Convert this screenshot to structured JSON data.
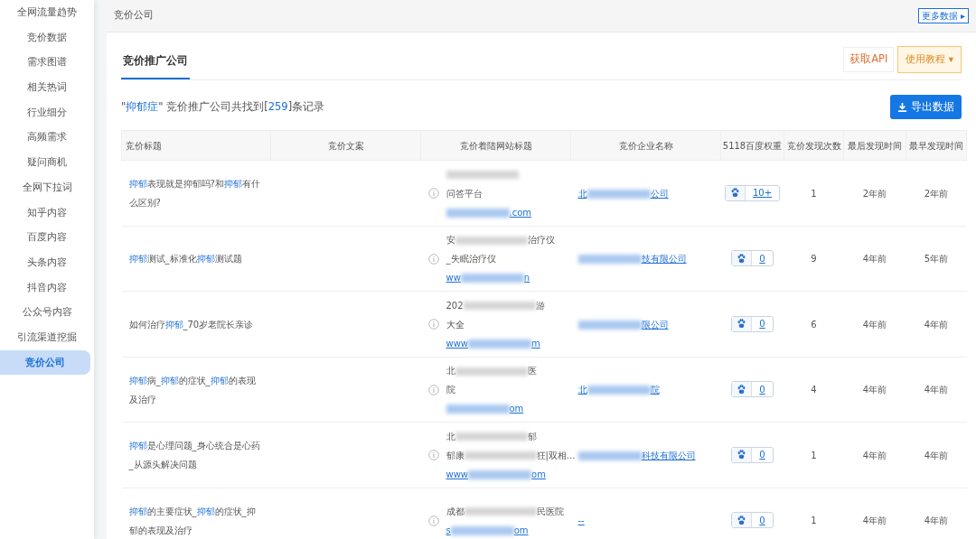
{
  "sidebar": {
    "items": [
      {
        "label": "全网流量趋势",
        "selected": false
      },
      {
        "label": "竞价数据",
        "selected": false
      },
      {
        "label": "需求图谱",
        "selected": false
      },
      {
        "label": "相关热词",
        "selected": false
      },
      {
        "label": "行业细分",
        "selected": false
      },
      {
        "label": "高频需求",
        "selected": false
      },
      {
        "label": "疑问商机",
        "selected": false
      },
      {
        "label": "全网下拉词",
        "selected": false
      },
      {
        "label": "知乎内容",
        "selected": false
      },
      {
        "label": "百度内容",
        "selected": false
      },
      {
        "label": "头条内容",
        "selected": false
      },
      {
        "label": "抖音内容",
        "selected": false
      },
      {
        "label": "公众号内容",
        "selected": false
      },
      {
        "label": "引流渠道挖掘",
        "selected": false
      },
      {
        "label": "竞价公司",
        "selected": true
      }
    ]
  },
  "header": {
    "title": "竞价公司",
    "more_button": "更多数据",
    "more_arrow": "▸"
  },
  "tabs": [
    {
      "label": "竞价推广公司",
      "selected": true
    }
  ],
  "actions": {
    "api_button": "获取API",
    "tutorial_button": "使用教程",
    "tutorial_caret": "▾",
    "export_button": "导出数据"
  },
  "summary": [
    {
      "text": "\"",
      "highlight": false
    },
    {
      "text": "抑郁症",
      "highlight": true
    },
    {
      "text": "\" 竞价推广公司共找到[",
      "highlight": false
    },
    {
      "text": "259",
      "highlight": true
    },
    {
      "text": "]条记录",
      "highlight": false
    }
  ],
  "table": {
    "columns": [
      "竞价标题",
      "竞价文案",
      "竞价着陆网站标题",
      "竞价企业名称",
      "5118百度权重",
      "竞价发现次数",
      "最后发现时间",
      "最早发现时间"
    ],
    "rows": [
      {
        "title": [
          {
            "text": "抑郁",
            "highlight": true
          },
          {
            "text": "表现就是抑郁吗?和",
            "highlight": false
          },
          {
            "text": "抑郁",
            "highlight": true
          },
          {
            "text": "有什么区别?",
            "highlight": false
          }
        ],
        "landing": [
          [
            {
              "kind": "blur"
            }
          ],
          [
            {
              "kind": "text",
              "text": "问答平台"
            }
          ]
        ],
        "url": [
          {
            "kind": "blur"
          },
          {
            "kind": "text",
            "text": ".com"
          }
        ],
        "company": [
          {
            "kind": "text",
            "text": "北"
          },
          {
            "kind": "blur"
          },
          {
            "kind": "text",
            "text": "公司"
          }
        ],
        "weight": "10+",
        "count": "1",
        "last": "2年前",
        "first": "2年前"
      },
      {
        "title": [
          {
            "text": "抑郁",
            "highlight": true
          },
          {
            "text": "测试_标准化",
            "highlight": false
          },
          {
            "text": "抑郁",
            "highlight": true
          },
          {
            "text": "测试题",
            "highlight": false
          }
        ],
        "landing": [
          [
            {
              "kind": "text",
              "text": "安"
            },
            {
              "kind": "blur"
            },
            {
              "kind": "text",
              "text": "治疗仪"
            }
          ],
          [
            {
              "kind": "text",
              "text": "_失眠治疗仪"
            }
          ]
        ],
        "url": [
          {
            "kind": "text",
            "text": "ww"
          },
          {
            "kind": "blur"
          },
          {
            "kind": "text",
            "text": "n"
          }
        ],
        "company": [
          {
            "kind": "blur"
          },
          {
            "kind": "text",
            "text": "技有限公司"
          }
        ],
        "weight": "0",
        "count": "9",
        "last": "4年前",
        "first": "5年前"
      },
      {
        "title": [
          {
            "text": "如何治疗",
            "highlight": false
          },
          {
            "text": "抑郁",
            "highlight": true
          },
          {
            "text": "_70岁老院长亲诊",
            "highlight": false
          }
        ],
        "landing": [
          [
            {
              "kind": "text",
              "text": "202"
            },
            {
              "kind": "blur"
            },
            {
              "kind": "text",
              "text": "游"
            }
          ],
          [
            {
              "kind": "text",
              "text": "大全"
            }
          ]
        ],
        "url": [
          {
            "kind": "text",
            "text": "www"
          },
          {
            "kind": "blur"
          },
          {
            "kind": "text",
            "text": "m"
          }
        ],
        "company": [
          {
            "kind": "blur"
          },
          {
            "kind": "text",
            "text": "限公司"
          }
        ],
        "weight": "0",
        "count": "6",
        "last": "4年前",
        "first": "4年前"
      },
      {
        "title": [
          {
            "text": "抑郁",
            "highlight": true
          },
          {
            "text": "病_",
            "highlight": false
          },
          {
            "text": "抑郁",
            "highlight": true
          },
          {
            "text": "的症状_",
            "highlight": false
          },
          {
            "text": "抑郁",
            "highlight": true
          },
          {
            "text": "的表现及治疗",
            "highlight": false
          }
        ],
        "landing": [
          [
            {
              "kind": "text",
              "text": "北"
            },
            {
              "kind": "blur"
            },
            {
              "kind": "text",
              "text": "医"
            }
          ],
          [
            {
              "kind": "text",
              "text": "院"
            }
          ]
        ],
        "url": [
          {
            "kind": "blur"
          },
          {
            "kind": "text",
            "text": "om"
          }
        ],
        "company": [
          {
            "kind": "text",
            "text": "北"
          },
          {
            "kind": "blur"
          },
          {
            "kind": "text",
            "text": "院"
          }
        ],
        "weight": "0",
        "count": "4",
        "last": "4年前",
        "first": "4年前"
      },
      {
        "title": [
          {
            "text": "抑郁",
            "highlight": true
          },
          {
            "text": "是心理问题_身心统合是心药_从源头解决问题",
            "highlight": false
          }
        ],
        "landing": [
          [
            {
              "kind": "text",
              "text": "北"
            },
            {
              "kind": "blur"
            },
            {
              "kind": "text",
              "text": "郁"
            }
          ],
          [
            {
              "kind": "text",
              "text": "郁康"
            },
            {
              "kind": "blur"
            },
            {
              "kind": "text",
              "text": "狂|双相..."
            }
          ]
        ],
        "url": [
          {
            "kind": "text",
            "text": "www"
          },
          {
            "kind": "blur"
          },
          {
            "kind": "text",
            "text": "om"
          }
        ],
        "company": [
          {
            "kind": "blur"
          },
          {
            "kind": "text",
            "text": "科技有限公司"
          }
        ],
        "weight": "0",
        "count": "1",
        "last": "4年前",
        "first": "4年前"
      },
      {
        "title": [
          {
            "text": "抑郁",
            "highlight": true
          },
          {
            "text": "的主要症状_",
            "highlight": false
          },
          {
            "text": "抑郁",
            "highlight": true
          },
          {
            "text": "的症状_抑郁的表现及治疗",
            "highlight": false
          }
        ],
        "landing": [
          [
            {
              "kind": "text",
              "text": "成都"
            },
            {
              "kind": "blur"
            },
            {
              "kind": "text",
              "text": "民医院"
            }
          ]
        ],
        "url": [
          {
            "kind": "text",
            "text": "s"
          },
          {
            "kind": "blur"
          },
          {
            "kind": "text",
            "text": "om"
          }
        ],
        "company": [
          {
            "kind": "text",
            "text": "--"
          }
        ],
        "weight": "0",
        "count": "1",
        "last": "4年前",
        "first": "4年前"
      }
    ]
  }
}
